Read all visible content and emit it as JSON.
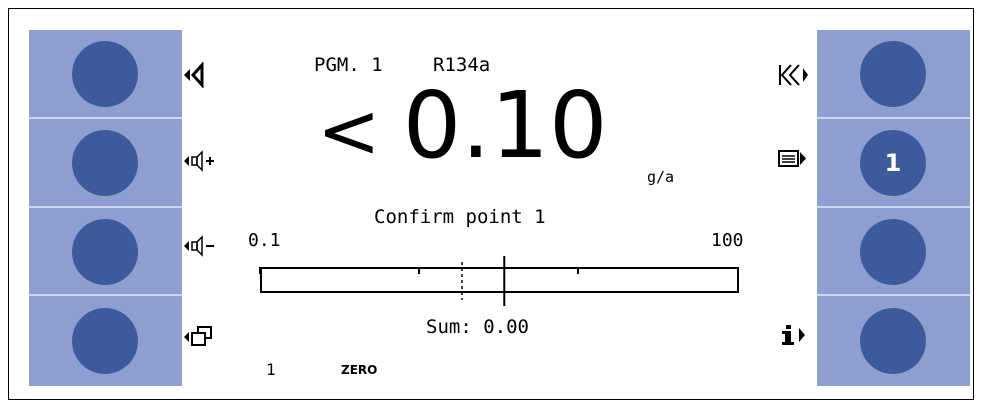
{
  "header": {
    "program": "PGM. 1",
    "refrigerant": "R134a"
  },
  "reading": {
    "prefix": "<",
    "value_int": "0",
    "value_dec": ".10",
    "unit": "g/a"
  },
  "status": {
    "message": "Confirm point 1"
  },
  "scale": {
    "min_label": "0.1",
    "max_label": "100",
    "marker_fraction": 0.51
  },
  "sum": {
    "label": "Sum: 0.00"
  },
  "footer": {
    "index": "1",
    "mode": "ZERO"
  },
  "softkeys": {
    "right_2_label": "1"
  },
  "icons": {
    "left": [
      "back-arrow-icon",
      "volume-up-icon",
      "volume-down-icon",
      "window-icon"
    ],
    "right": [
      "skip-back-icon",
      "menu-list-icon",
      "info-icon"
    ]
  },
  "colors": {
    "panel": "#8f9ed1",
    "button": "#3d5b9c",
    "separator": "#cdd5ef"
  }
}
